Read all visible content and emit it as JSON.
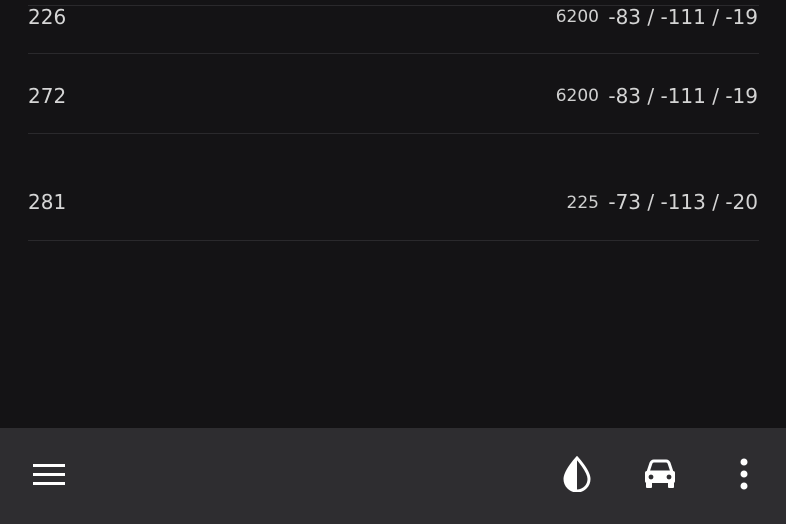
{
  "rows": [
    {
      "id": "226",
      "frequency": "6200",
      "signal": "-83 / -111 / -19"
    },
    {
      "id": "272",
      "frequency": "6200",
      "signal": "-83 / -111 / -19"
    },
    {
      "id": "281",
      "frequency": "225",
      "signal": "-73 / -113 / -20"
    }
  ],
  "bottom_bar": {
    "menu_icon": "hamburger-menu-icon",
    "drop_icon": "water-drop-icon",
    "car_icon": "car-icon",
    "more_icon": "more-vertical-icon"
  },
  "colors": {
    "background": "#141315",
    "bottom_bar": "#2e2d30",
    "text": "#d6d6d6",
    "icon": "#ffffff",
    "divider": "#2a292c"
  }
}
